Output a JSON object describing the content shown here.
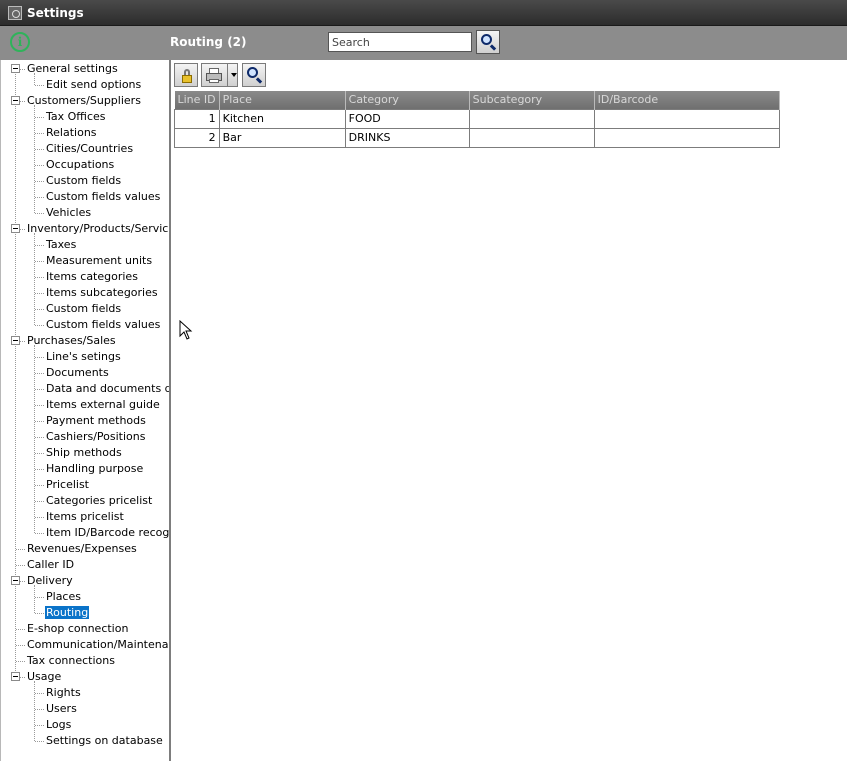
{
  "window": {
    "title": "Settings",
    "app_icon": "gear-icon"
  },
  "header": {
    "title": "Routing (2)",
    "search_placeholder": "Search",
    "info_icon": "info-icon",
    "info_glyph": "i"
  },
  "toolbar": {
    "lock_icon": "lock-icon",
    "print_icon": "printer-icon",
    "find_icon": "search-icon"
  },
  "sidebar": {
    "items": [
      {
        "label": "General settings",
        "level": 0,
        "expanded": true
      },
      {
        "label": "Edit send options",
        "level": 1
      },
      {
        "label": "Customers/Suppliers",
        "level": 0,
        "expanded": true
      },
      {
        "label": "Tax Offices",
        "level": 1
      },
      {
        "label": "Relations",
        "level": 1
      },
      {
        "label": "Cities/Countries",
        "level": 1
      },
      {
        "label": "Occupations",
        "level": 1
      },
      {
        "label": "Custom fields",
        "level": 1
      },
      {
        "label": "Custom fields values",
        "level": 1
      },
      {
        "label": "Vehicles",
        "level": 1
      },
      {
        "label": "Inventory/Products/Services",
        "level": 0,
        "expanded": true
      },
      {
        "label": "Taxes",
        "level": 1
      },
      {
        "label": "Measurement units",
        "level": 1
      },
      {
        "label": "Items categories",
        "level": 1
      },
      {
        "label": "Items subcategories",
        "level": 1
      },
      {
        "label": "Custom fields",
        "level": 1
      },
      {
        "label": "Custom fields values",
        "level": 1
      },
      {
        "label": "Purchases/Sales",
        "level": 0,
        "expanded": true
      },
      {
        "label": "Line's setings",
        "level": 1
      },
      {
        "label": "Documents",
        "level": 1
      },
      {
        "label": "Data and documents desi",
        "level": 1
      },
      {
        "label": "Items external guide",
        "level": 1
      },
      {
        "label": "Payment methods",
        "level": 1
      },
      {
        "label": "Cashiers/Positions",
        "level": 1
      },
      {
        "label": "Ship methods",
        "level": 1
      },
      {
        "label": "Handling purpose",
        "level": 1
      },
      {
        "label": "Pricelist",
        "level": 1
      },
      {
        "label": "Categories pricelist",
        "level": 1
      },
      {
        "label": "Items pricelist",
        "level": 1
      },
      {
        "label": "Item ID/Barcode recognize",
        "level": 1
      },
      {
        "label": "Revenues/Expenses",
        "level": 0
      },
      {
        "label": "Caller ID",
        "level": 0
      },
      {
        "label": "Delivery",
        "level": 0,
        "expanded": true
      },
      {
        "label": "Places",
        "level": 1
      },
      {
        "label": "Routing",
        "level": 1,
        "selected": true
      },
      {
        "label": "E-shop connection",
        "level": 0
      },
      {
        "label": "Communication/Maintenance",
        "level": 0
      },
      {
        "label": "Tax connections",
        "level": 0
      },
      {
        "label": "Usage",
        "level": 0,
        "expanded": true
      },
      {
        "label": "Rights",
        "level": 1
      },
      {
        "label": "Users",
        "level": 1
      },
      {
        "label": "Logs",
        "level": 1
      },
      {
        "label": "Settings on database",
        "level": 1
      }
    ]
  },
  "grid": {
    "columns": [
      "Line ID",
      "Place",
      "Category",
      "Subcategory",
      "ID/Barcode"
    ],
    "rows": [
      [
        "1",
        "Kitchen",
        "FOOD",
        "",
        ""
      ],
      [
        "2",
        "Bar",
        "DRINKS",
        "",
        ""
      ]
    ]
  },
  "colors": {
    "selection": "#0a73c9",
    "header_bar": "#8c8c8c",
    "info_green": "#2fb35a"
  }
}
